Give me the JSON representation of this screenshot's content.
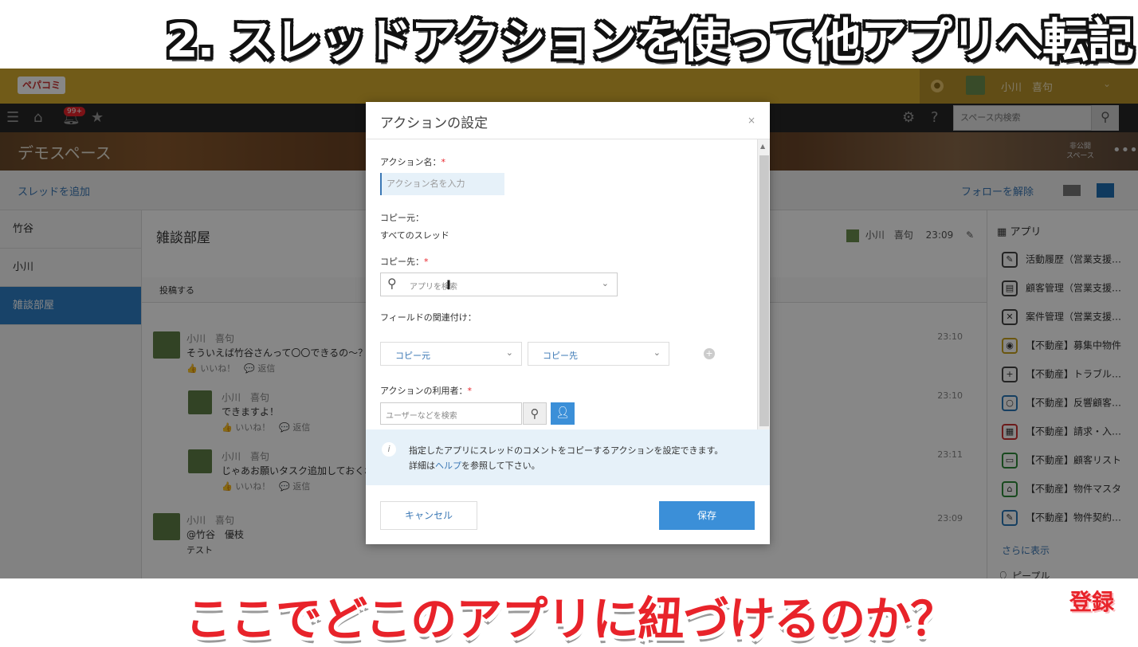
{
  "captions": {
    "top": "2. スレッドアクションを使って他アプリへ転記",
    "bottom": "ここでどこのアプリに紐づけるのか？",
    "subscribe": "登録"
  },
  "header": {
    "logo": "ペパコミ",
    "user_name": "小川　喜句"
  },
  "nav": {
    "notification_badge": "99+",
    "search_placeholder": "スペース内検索"
  },
  "space": {
    "title": "デモスペース",
    "visibility": "非公開\nスペース",
    "add_thread": "スレッドを追加",
    "unfollow": "フォローを解除"
  },
  "sidebar": {
    "items": [
      {
        "label": "竹谷"
      },
      {
        "label": "小川"
      },
      {
        "label": "雑談部屋"
      }
    ]
  },
  "thread": {
    "title": "雑談部屋",
    "author": "小川　喜句",
    "time": "23:09",
    "post_tab": "投稿する",
    "comments": [
      {
        "name": "小川　喜句",
        "text": "そういえば竹谷さんって〇〇できるの〜？",
        "actions": "👍 いいね！　💬 返信",
        "time": "23:10"
      },
      {
        "name": "小川　喜句",
        "text": "できますよ！",
        "actions": "👍 いいね！　💬 返信",
        "time": "23:10"
      },
      {
        "name": "小川　喜句",
        "text": "じゃあお願いタスク追加しておくね！",
        "actions": "👍 いいね！　💬 返信",
        "time": "23:11"
      },
      {
        "name": "小川　喜句",
        "mention": "@竹谷　優枝",
        "text": "テスト",
        "time": "23:09"
      }
    ]
  },
  "right_panel": {
    "heading": "アプリ",
    "apps": [
      "活動履歴（営業支援…",
      "顧客管理（営業支援…",
      "案件管理（営業支援…",
      "【不動産】募集中物件",
      "【不動産】トラブル…",
      "【不動産】反響顧客…",
      "【不動産】請求・入…",
      "【不動産】顧客リスト",
      "【不動産】物件マスタ",
      "【不動産】物件契約…"
    ],
    "more": "さらに表示",
    "people": "ピープル"
  },
  "modal": {
    "title": "アクションの設定",
    "close": "×",
    "action_name_label": "アクション名：",
    "action_name_placeholder": "アクション名を入力",
    "source_label": "コピー元：",
    "source_value": "すべてのスレッド",
    "dest_label": "コピー先：",
    "dest_placeholder": "アプリを検索",
    "field_mapping_label": "フィールドの関連付け：",
    "field_source": "コピー元",
    "field_dest": "コピー先",
    "users_label": "アクションの利用者：",
    "users_placeholder": "ユーザーなどを検索",
    "required_mark": "*",
    "info_line1": "指定したアプリにスレッドのコメントをコピーするアクションを設定できます。",
    "info_line2_prefix": "詳細は",
    "info_link": "ヘルプ",
    "info_line2_suffix": "を参照して下さい。",
    "cancel": "キャンセル",
    "save": "保存"
  }
}
